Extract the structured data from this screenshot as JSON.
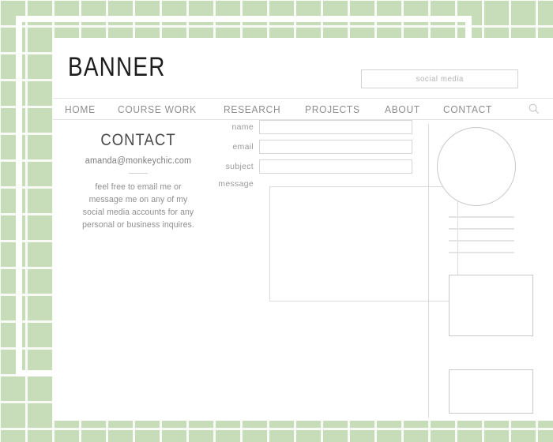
{
  "site": {
    "banner_title": "BANNER"
  },
  "search_box": {
    "placeholder": "social media",
    "value": "",
    "icon": "search-icon"
  },
  "nav": {
    "items": [
      {
        "label": "HOME"
      },
      {
        "label": "COURSE WORK"
      },
      {
        "label": "RESEARCH"
      },
      {
        "label": "PROJECTS"
      },
      {
        "label": "ABOUT"
      },
      {
        "label": "CONTACT"
      }
    ],
    "search_icon": "magnifier-icon"
  },
  "left_column": {
    "heading": "CONTACT",
    "email": "amanda@monkeychic.com",
    "blurb": "feel free to email me or message me on any of my social media accounts for any personal or business inquires."
  },
  "form": {
    "fields": [
      {
        "label": "name",
        "value": "",
        "placeholder": ""
      },
      {
        "label": "email",
        "value": "",
        "placeholder": ""
      },
      {
        "label": "subject",
        "value": "",
        "placeholder": ""
      }
    ],
    "message_label": "message",
    "message_value": "",
    "message_placeholder": ""
  },
  "right_column": {
    "avatar": "profile-circle-placeholder",
    "text_lines": 4,
    "thumbnails": [
      {
        "name": "thumbnail-large"
      },
      {
        "name": "thumbnail-small"
      }
    ]
  },
  "colors": {
    "background_green": "#c7ddb9",
    "grid_line": "#ffffff",
    "page_white": "#ffffff",
    "text_dark": "#1d1d1d",
    "text_muted": "#8f8f8f",
    "border_light": "#d6d6d6"
  }
}
